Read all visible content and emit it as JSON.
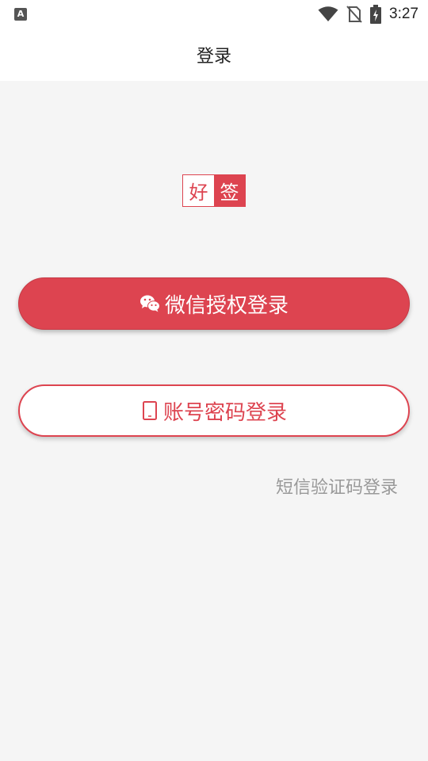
{
  "status_bar": {
    "notification_icon_letter": "A",
    "time": "3:27",
    "icons": [
      "wifi-icon",
      "no-sim-icon",
      "battery-charging-icon"
    ]
  },
  "header": {
    "title": "登录"
  },
  "logo": {
    "char1": "好",
    "char2": "签"
  },
  "buttons": {
    "wechat_label": "微信授权登录",
    "account_label": "账号密码登录"
  },
  "links": {
    "sms_login": "短信验证码登录"
  },
  "colors": {
    "accent": "#dd4450",
    "background": "#f5f5f5",
    "muted_text": "#999999"
  }
}
